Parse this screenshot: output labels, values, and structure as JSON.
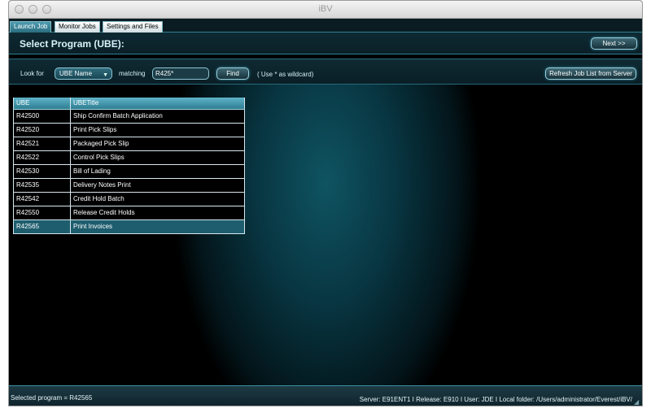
{
  "window": {
    "title": "iBV"
  },
  "tabs": [
    {
      "label": "Launch Job",
      "active": true
    },
    {
      "label": "Monitor Jobs",
      "active": false
    },
    {
      "label": "Settings and Files",
      "active": false
    }
  ],
  "header": {
    "title": "Select Program (UBE):",
    "next_label": "Next >>"
  },
  "search": {
    "look_for_label": "Look for",
    "select_value": "UBE Name",
    "matching_label": "matching",
    "field_value": "R425*",
    "find_label": "Find",
    "hint": "( Use * as wildcard)",
    "refresh_label": "Refresh Job List from Server"
  },
  "table": {
    "columns": [
      "UBE",
      "UBETitle"
    ],
    "rows": [
      [
        "R42500",
        "Ship Confirm Batch Application"
      ],
      [
        "R42520",
        "Print Pick Slips"
      ],
      [
        "R42521",
        "Packaged Pick Slip"
      ],
      [
        "R42522",
        "Control Pick Slips"
      ],
      [
        "R42530",
        "Bill of Lading"
      ],
      [
        "R42535",
        "Delivery Notes Print"
      ],
      [
        "R42542",
        "Credit Hold Batch"
      ],
      [
        "R42550",
        "Release Credit Holds"
      ],
      [
        "R42565",
        "Print Invoices"
      ]
    ],
    "selected_index": 8
  },
  "status": {
    "left": "Selected program = R42565",
    "right": "Server: E91ENT1 I Release: E910 I User: JDE I Local folder: /Users/administrator/Everest/iBV/"
  },
  "colors": {
    "accent": "#2f7f93",
    "selected_row": "#1e5d6e",
    "header_row": "#5fb4c9"
  }
}
